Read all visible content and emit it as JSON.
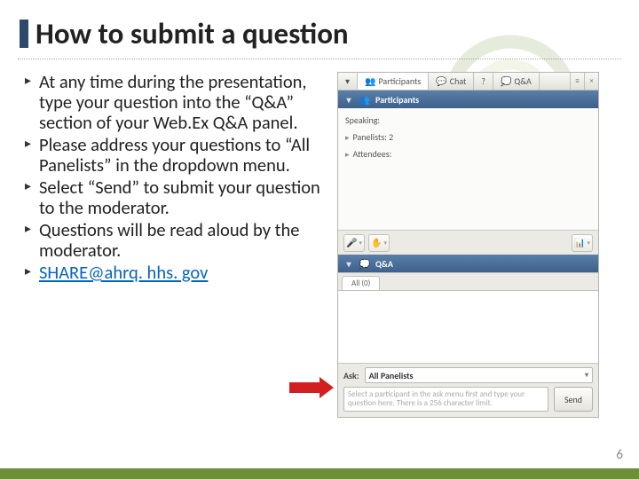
{
  "title": "How to submit a question",
  "bullets": {
    "b1": "At any time during the presentation, type your question into the “Q&A” section of your Web.Ex Q&A panel.",
    "b2": "Please address your questions to “All Panelists” in the dropdown menu.",
    "b3": "Select “Send” to submit your question to the moderator.",
    "b4": "Questions will be read aloud by the moderator.",
    "b5": "SHARE@ahrq. hhs. gov"
  },
  "webex": {
    "tabs": {
      "participants": "Participants",
      "chat": "Chat",
      "help": "?",
      "qa": "Q&A"
    },
    "participants_header": "Participants",
    "speaking_label": "Speaking:",
    "panelists_label": "Panelists: 2",
    "attendees_label": "Attendees:",
    "qa_header": "Q&A",
    "qa_tab_label": "All (0)",
    "ask_label": "Ask:",
    "ask_value": "All Panelists",
    "placeholder": "Select a participant in the ask menu first and type your question here. There is a 256 character limit.",
    "send_label": "Send"
  },
  "page_number": "6"
}
